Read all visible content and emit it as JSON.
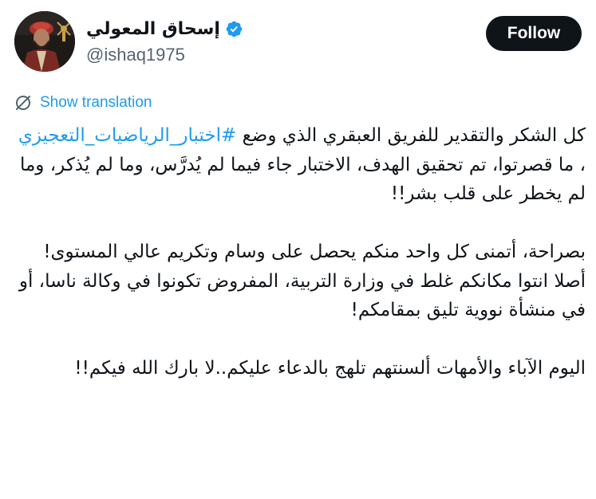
{
  "author": {
    "display_name": "إسحاق المعولي",
    "handle": "@ishaq1975",
    "verified": true,
    "avatar_icon": "profile-photo"
  },
  "actions": {
    "follow_label": "Follow"
  },
  "translation": {
    "label": "Show translation",
    "icon": "globe-translate-icon"
  },
  "tweet": {
    "p1_a": "كل الشكر والتقدير للفريق العبقري الذي وضع",
    "hashtag": "#اختبار_الرياضيات_التعجيزي",
    "p1_b": "، ما قصرتوا، تم تحقيق الهدف، الاختبار جاء فيما لم يُدرَّس، وما لم يُذكر، وما لم يخطر على قلب بشر!!",
    "p2": "بصراحة، أتمنى كل واحد منكم يحصل على وسام وتكريم عالي المستوى! أصلا انتوا مكانكم غلط في وزارة التربية، المفروض تكونوا في وكالة ناسا، أو في منشأة نووية تليق بمقامكم!",
    "p3": "اليوم الآباء والأمهات ألسنتهم تلهج بالدعاء عليكم..لا بارك الله فيكم!!"
  },
  "colors": {
    "link": "#1d9bf0",
    "text": "#0f1419",
    "secondary": "#536471",
    "button_bg": "#0f1419"
  }
}
